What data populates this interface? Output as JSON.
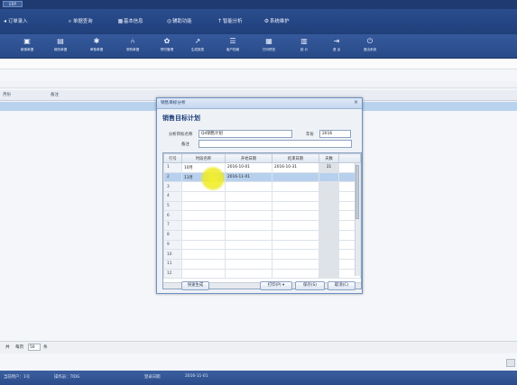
{
  "window": {
    "title_tab": "ERP"
  },
  "topnav": [
    {
      "icon": "back-arrow-icon",
      "glyph": "◂",
      "label": "订单录入"
    },
    {
      "icon": "search-icon",
      "glyph": "⌕",
      "label": "单据查询"
    },
    {
      "icon": "grid-icon",
      "glyph": "▦",
      "label": "基本信息"
    },
    {
      "icon": "settings-icon",
      "glyph": "◎",
      "label": "辅助功能"
    },
    {
      "icon": "upload-icon",
      "glyph": "↑",
      "label": "智能分析"
    },
    {
      "icon": "gear-icon",
      "glyph": "⚙",
      "label": "系统维护"
    }
  ],
  "toolbar": [
    {
      "icon": "new-icon",
      "glyph": "▣",
      "label": "新增单据"
    },
    {
      "icon": "edit-icon",
      "glyph": "▤",
      "label": "修改单据"
    },
    {
      "icon": "audit-icon",
      "glyph": "✱",
      "label": "审核单据"
    },
    {
      "icon": "purchase-icon",
      "glyph": "⑃",
      "label": "采购单据"
    },
    {
      "icon": "config-icon",
      "glyph": "✿",
      "label": "预付管理"
    },
    {
      "icon": "export-icon",
      "glyph": "↗",
      "label": "生成报表"
    },
    {
      "icon": "list-icon",
      "glyph": "☰",
      "label": "客户档案"
    },
    {
      "icon": "print-icon",
      "glyph": "▦",
      "label": "打印预览"
    },
    {
      "icon": "chart-icon",
      "glyph": "▥",
      "label": "统 计"
    },
    {
      "icon": "logout-icon",
      "glyph": "⇥",
      "label": "退 出"
    },
    {
      "icon": "power-icon",
      "glyph": "⏻",
      "label": "退出系统"
    }
  ],
  "grid": {
    "col1": "月份",
    "col2": "备注"
  },
  "pager": {
    "prefix": "共",
    "per_page_label": "每页",
    "per_page_value": "50",
    "suffix": "条"
  },
  "status": {
    "item1": "当前用户：1号",
    "item2": "操作员：TIDG",
    "item3": "登录日期",
    "item4": "2016-11-01"
  },
  "dialog": {
    "title": "销售目标分析",
    "heading": "销售目标计划",
    "plan_name_label": "分析目标名称",
    "plan_name_value": "Q4销售计划",
    "year_label": "年份",
    "year_value": "2016",
    "note_label": "备注",
    "note_value": "",
    "columns": [
      "行号",
      "时段名称",
      "开始日期",
      "结束日期",
      "天数"
    ],
    "rows": [
      {
        "no": "1",
        "name": "10月",
        "start": "2016-10-01",
        "end": "2016-10-31",
        "days": "31"
      },
      {
        "no": "2",
        "name": "11月",
        "start": "2016-11-01",
        "end": "",
        "days": ""
      },
      {
        "no": "3",
        "name": "",
        "start": "",
        "end": "",
        "days": ""
      },
      {
        "no": "4",
        "name": "",
        "start": "",
        "end": "",
        "days": ""
      },
      {
        "no": "5",
        "name": "",
        "start": "",
        "end": "",
        "days": ""
      },
      {
        "no": "6",
        "name": "",
        "start": "",
        "end": "",
        "days": ""
      },
      {
        "no": "7",
        "name": "",
        "start": "",
        "end": "",
        "days": ""
      },
      {
        "no": "8",
        "name": "",
        "start": "",
        "end": "",
        "days": ""
      },
      {
        "no": "9",
        "name": "",
        "start": "",
        "end": "",
        "days": ""
      },
      {
        "no": "10",
        "name": "",
        "start": "",
        "end": "",
        "days": ""
      },
      {
        "no": "11",
        "name": "",
        "start": "",
        "end": "",
        "days": ""
      },
      {
        "no": "12",
        "name": "",
        "start": "",
        "end": "",
        "days": ""
      }
    ],
    "selected_row": 1,
    "buttons": {
      "quick": "快速生成",
      "print": "打印(P) ▾",
      "save": "保存(S)",
      "cancel": "取消(C)"
    },
    "row2_marker": "1"
  },
  "colors": {
    "nav": "#203f7a",
    "selection": "#b7d0ee",
    "highlight": "#f6f324"
  }
}
